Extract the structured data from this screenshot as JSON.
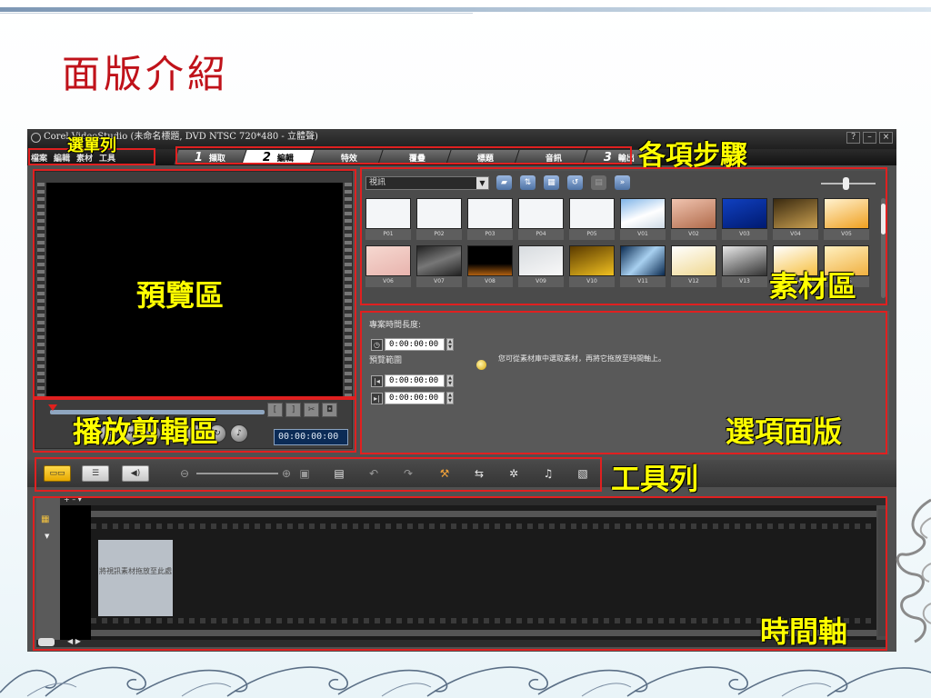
{
  "slide": {
    "title": "面版介紹"
  },
  "app": {
    "window_title": "Corel VideoStudio (未命名標題, DVD NTSC 720*480 - 立體聲)",
    "window_buttons": [
      "?",
      "–",
      "×"
    ],
    "menus": [
      "檔案",
      "編輯",
      "素材",
      "工具"
    ],
    "steps": [
      {
        "num": "1",
        "label": "擷取",
        "active": false
      },
      {
        "num": "2",
        "label": "編輯",
        "active": true
      },
      {
        "num": "",
        "label": "特效",
        "active": false
      },
      {
        "num": "",
        "label": "覆疊",
        "active": false
      },
      {
        "num": "",
        "label": "標題",
        "active": false
      },
      {
        "num": "",
        "label": "音訊",
        "active": false
      },
      {
        "num": "3",
        "label": "輸出",
        "active": false
      }
    ],
    "preview": {
      "timecode": "00:00:00:00"
    },
    "library": {
      "category": "視訊",
      "thumbnails": [
        {
          "label": "P01"
        },
        {
          "label": "P02"
        },
        {
          "label": "P03"
        },
        {
          "label": "P04"
        },
        {
          "label": "P05"
        },
        {
          "label": "V01"
        },
        {
          "label": "V02"
        },
        {
          "label": "V03"
        },
        {
          "label": "V04"
        },
        {
          "label": "V05"
        },
        {
          "label": "V06"
        },
        {
          "label": "V07"
        },
        {
          "label": "V08"
        },
        {
          "label": "V09"
        },
        {
          "label": "V10"
        },
        {
          "label": "V11"
        },
        {
          "label": "V12"
        },
        {
          "label": "V13"
        },
        {
          "label": "V14"
        },
        {
          "label": "V15"
        }
      ]
    },
    "options": {
      "project_duration_label": "專案時間長度:",
      "project_duration": "0:00:00:00",
      "preview_range_label": "預覽範圍",
      "range_start": "0:00:00:00",
      "range_end": "0:00:00:00",
      "hint": "您可從素材庫中選取素材，再將它拖放至時間軸上。"
    },
    "timeline": {
      "drop_hint": "將視訊素材拖放至此處"
    }
  },
  "annotations": {
    "menubar": "選單列",
    "steps": "各項步驟",
    "preview": "預覽區",
    "playback": "播放剪輯區",
    "library": "素材區",
    "options": "選項面版",
    "toolbar": "工具列",
    "timeline": "時間軸"
  },
  "colors": {
    "title": "#c0121a",
    "annotation_box": "#e02020",
    "annotation_text": "#ffff00"
  }
}
